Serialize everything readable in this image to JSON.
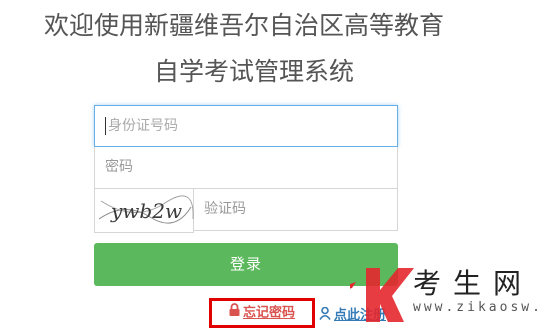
{
  "title": {
    "line1": "欢迎使用新疆维吾尔自治区高等教育",
    "line2": "自学考试管理系统"
  },
  "form": {
    "id_placeholder": "身份证号码",
    "password_placeholder": "密码",
    "captcha_placeholder": "验证码",
    "captcha_text": "ywb2w",
    "login_label": "登录",
    "forgot_label": "忘记密码",
    "register_label": "点此注册"
  },
  "watermark": {
    "text": "考生网",
    "url": "www.zikaosw.cn",
    "logo_letter": "K"
  },
  "colors": {
    "primary_green": "#5cb85c",
    "forgot_red": "#d9534f",
    "highlight_box": "#e00000",
    "link_blue": "#337ab7",
    "focus_border": "#66afe9"
  },
  "icons": {
    "forgot": "lock-icon",
    "register": "user-icon"
  }
}
